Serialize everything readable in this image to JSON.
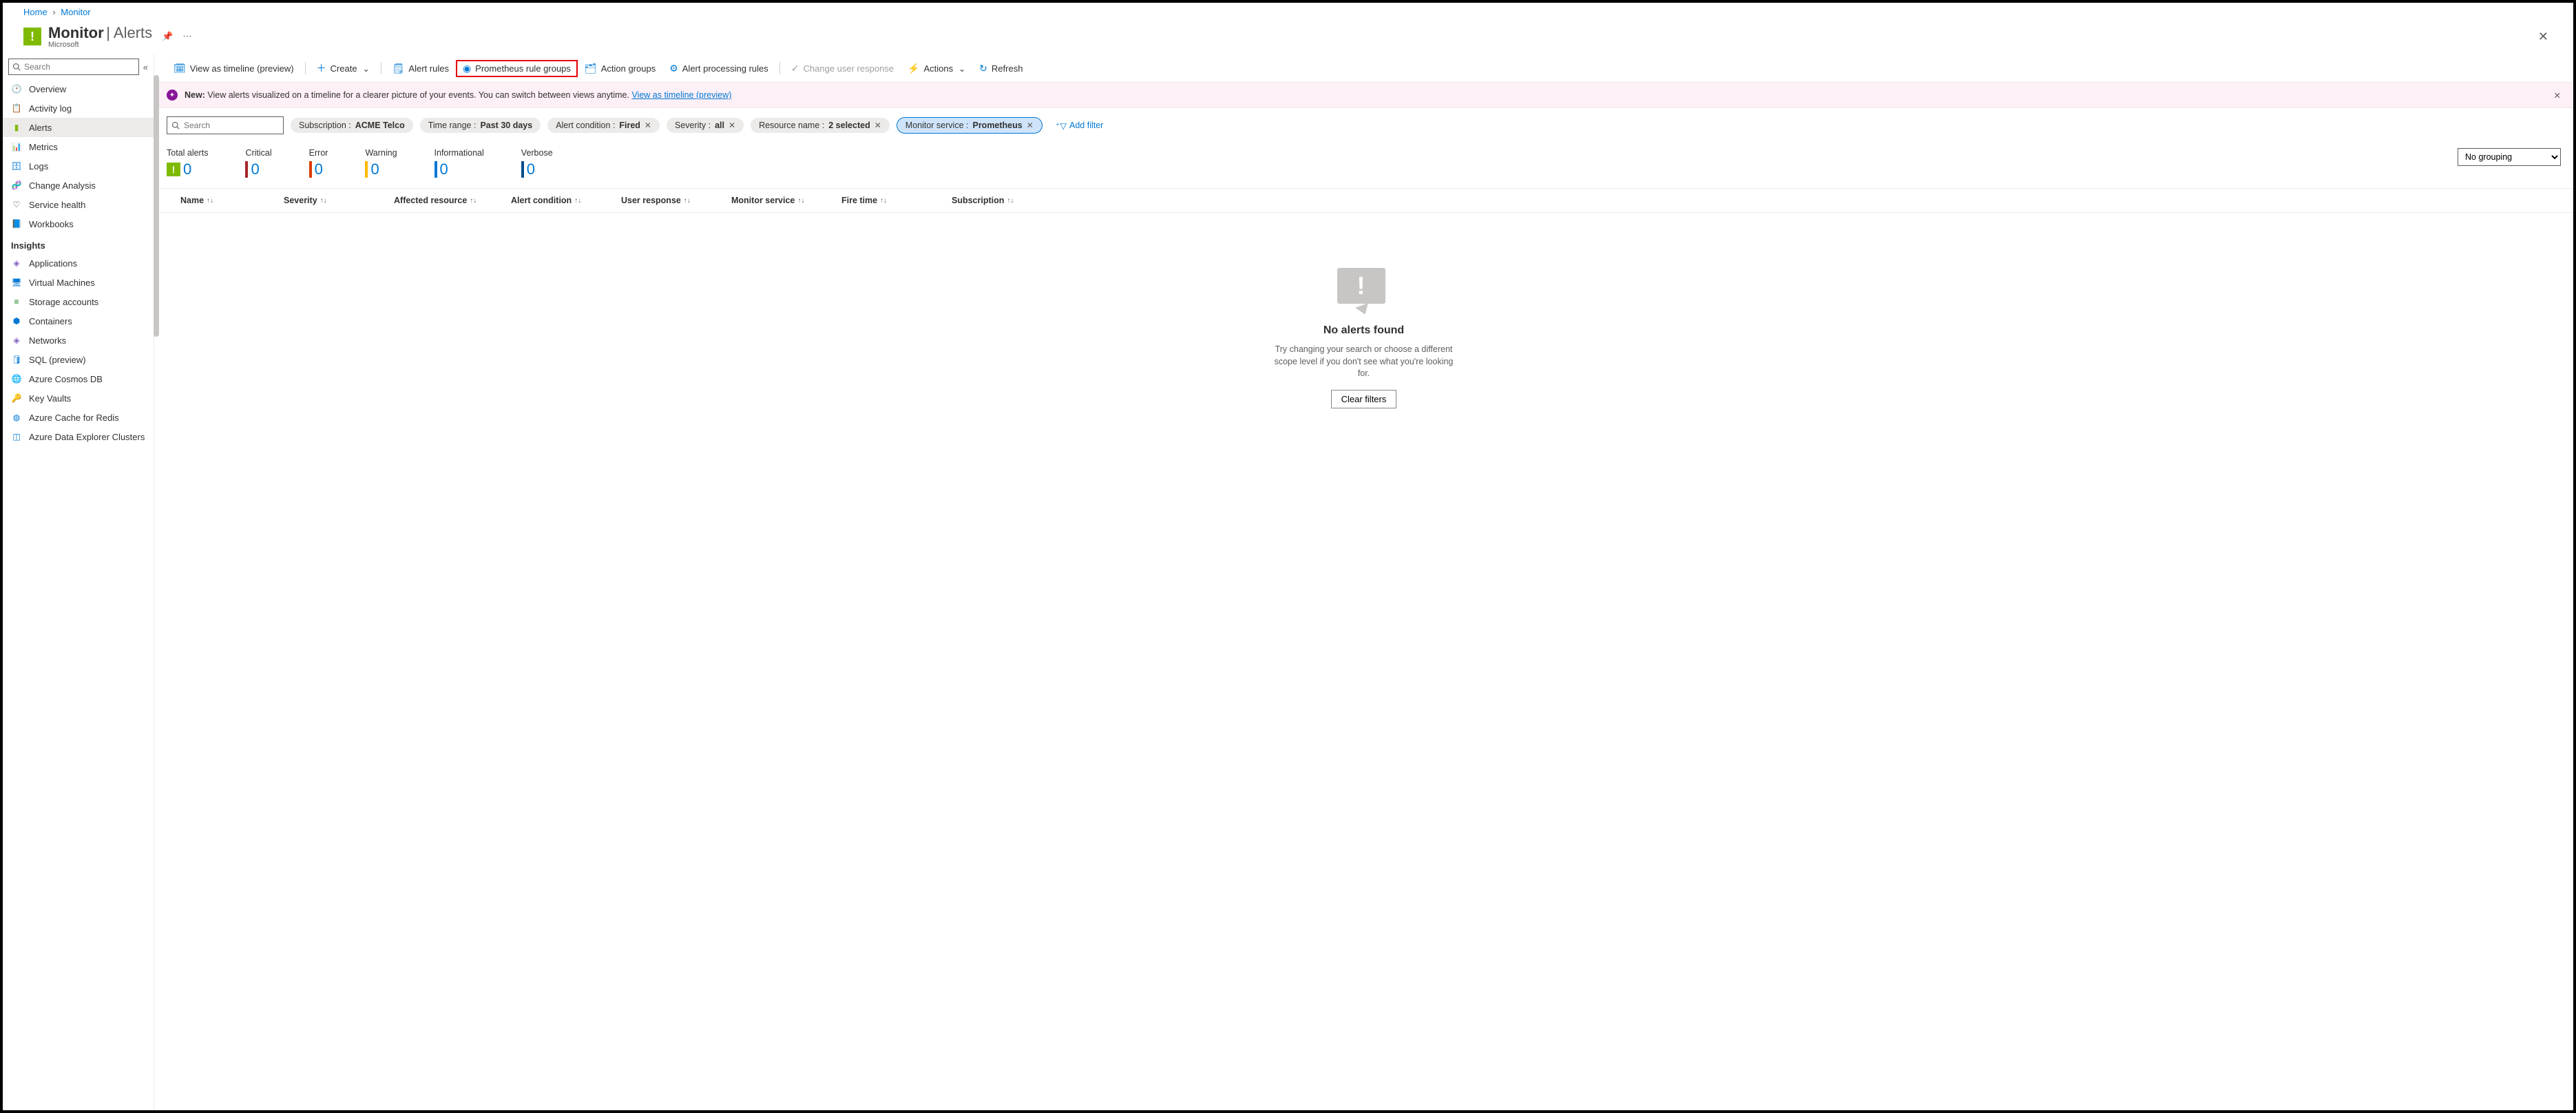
{
  "breadcrumb": {
    "home": "Home",
    "monitor": "Monitor"
  },
  "header": {
    "title": "Monitor",
    "sub": "Alerts",
    "vendor": "Microsoft"
  },
  "sidebar": {
    "search_placeholder": "Search",
    "items": [
      {
        "label": "Overview",
        "icon": "🕑",
        "color": "#605e5c"
      },
      {
        "label": "Activity log",
        "icon": "📋",
        "color": "#0078d4"
      },
      {
        "label": "Alerts",
        "icon": "▮",
        "color": "#7fba00",
        "selected": true
      },
      {
        "label": "Metrics",
        "icon": "📊",
        "color": "#0078d4"
      },
      {
        "label": "Logs",
        "icon": "🗄",
        "color": "#0078d4"
      },
      {
        "label": "Change Analysis",
        "icon": "🧬",
        "color": "#8661c5"
      },
      {
        "label": "Service health",
        "icon": "♡",
        "color": "#323130"
      },
      {
        "label": "Workbooks",
        "icon": "📘",
        "color": "#0078d4"
      }
    ],
    "insights_label": "Insights",
    "insights": [
      {
        "label": "Applications",
        "icon": "◈",
        "color": "#8661c5"
      },
      {
        "label": "Virtual Machines",
        "icon": "🖥",
        "color": "#0078d4"
      },
      {
        "label": "Storage accounts",
        "icon": "≡",
        "color": "#107c10"
      },
      {
        "label": "Containers",
        "icon": "⬢",
        "color": "#0078d4"
      },
      {
        "label": "Networks",
        "icon": "◈",
        "color": "#8661c5"
      },
      {
        "label": "SQL (preview)",
        "icon": "🛢",
        "color": "#0078d4"
      },
      {
        "label": "Azure Cosmos DB",
        "icon": "🌐",
        "color": "#0078d4"
      },
      {
        "label": "Key Vaults",
        "icon": "🔑",
        "color": "#ffb900"
      },
      {
        "label": "Azure Cache for Redis",
        "icon": "◍",
        "color": "#0078d4"
      },
      {
        "label": "Azure Data Explorer Clusters",
        "icon": "◫",
        "color": "#0078d4"
      }
    ]
  },
  "toolbar": {
    "timeline": "View as timeline (preview)",
    "create": "Create",
    "alert_rules": "Alert rules",
    "prom_groups": "Prometheus rule groups",
    "action_groups": "Action groups",
    "processing": "Alert processing rules",
    "change_resp": "Change user response",
    "actions": "Actions",
    "refresh": "Refresh"
  },
  "banner": {
    "new": "New:",
    "text": "View alerts visualized on a timeline for a clearer picture of your events. You can switch between views anytime.",
    "link": "View as timeline (preview)"
  },
  "filters": {
    "search_placeholder": "Search",
    "subscription": {
      "label": "Subscription :",
      "value": "ACME Telco"
    },
    "time_range": {
      "label": "Time range :",
      "value": "Past 30 days"
    },
    "condition": {
      "label": "Alert condition :",
      "value": "Fired"
    },
    "severity": {
      "label": "Severity :",
      "value": "all"
    },
    "resource": {
      "label": "Resource name :",
      "value": "2 selected"
    },
    "service": {
      "label": "Monitor service :",
      "value": "Prometheus"
    },
    "add": "Add filter"
  },
  "summary": {
    "total": {
      "label": "Total alerts",
      "value": "0"
    },
    "critical": {
      "label": "Critical",
      "value": "0",
      "color": "#a4262c"
    },
    "error": {
      "label": "Error",
      "value": "0",
      "color": "#d83b01"
    },
    "warning": {
      "label": "Warning",
      "value": "0",
      "color": "#ffb900"
    },
    "info": {
      "label": "Informational",
      "value": "0",
      "color": "#0078d4"
    },
    "verbose": {
      "label": "Verbose",
      "value": "0",
      "color": "#004e8c"
    },
    "grouping": "No grouping"
  },
  "columns": [
    "Name",
    "Severity",
    "Affected resource",
    "Alert condition",
    "User response",
    "Monitor service",
    "Fire time",
    "Subscription"
  ],
  "empty": {
    "title": "No alerts found",
    "text": "Try changing your search or choose a different scope level if you don't see what you're looking for.",
    "button": "Clear filters"
  }
}
